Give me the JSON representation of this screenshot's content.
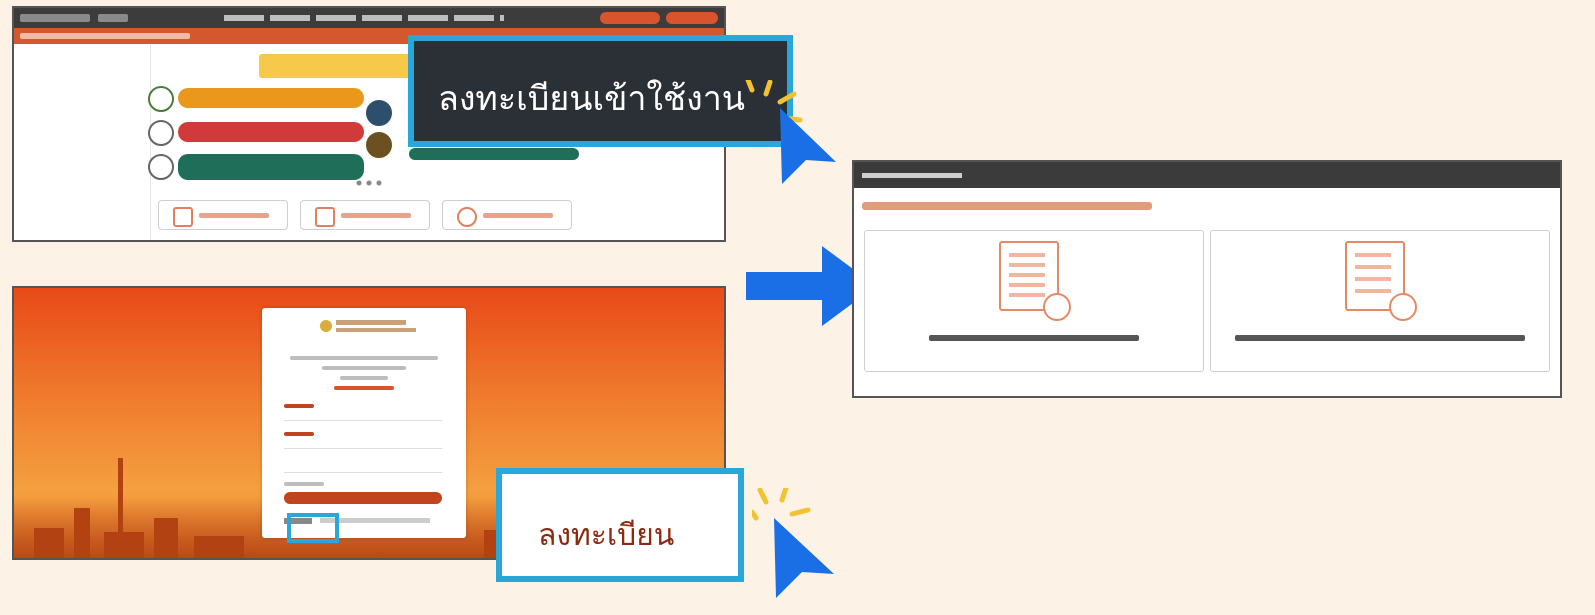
{
  "callouts": {
    "register_login": "ลงทะเบียนเข้าใช้งาน",
    "register": "ลงทะเบียน"
  },
  "colors": {
    "background": "#fcf3e6",
    "callout_border": "#29a7d8",
    "arrow_blue": "#1a6ee6",
    "brand_orange": "#d9532c"
  },
  "icons": {
    "flow_arrow": "right-arrow-icon",
    "pointer": "mouse-cursor-icon"
  }
}
